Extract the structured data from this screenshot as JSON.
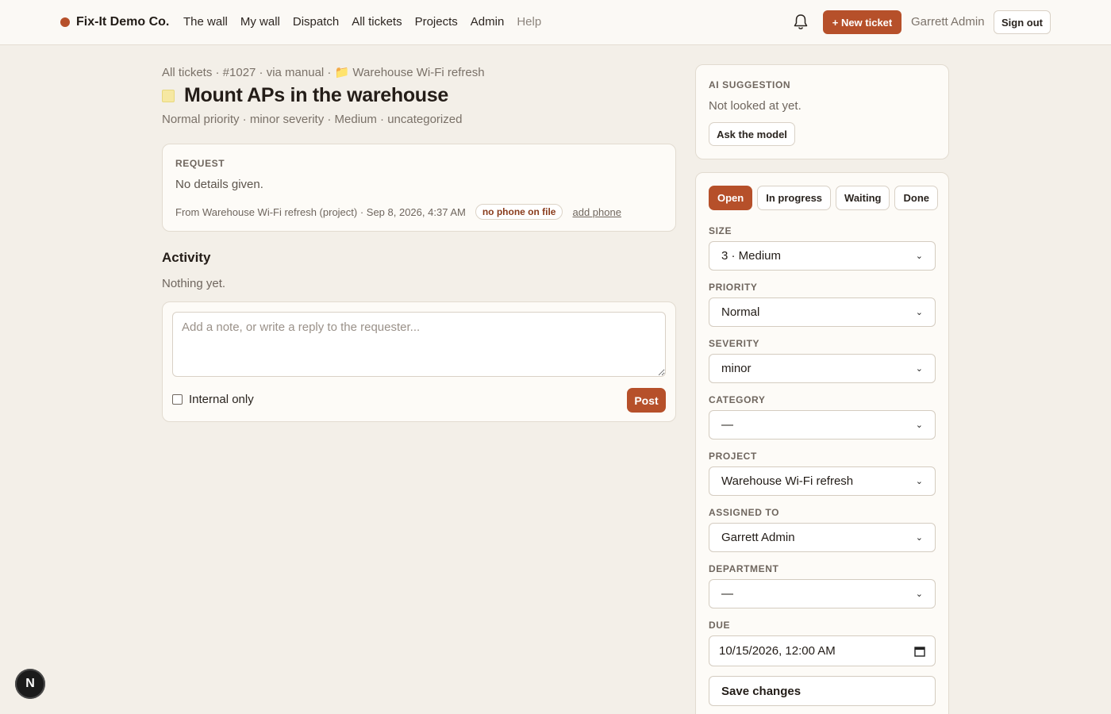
{
  "brand": {
    "name": "Fix-It Demo Co.",
    "dot_color": "#b6502a"
  },
  "nav": {
    "items": [
      {
        "label": "The wall"
      },
      {
        "label": "My wall"
      },
      {
        "label": "Dispatch"
      },
      {
        "label": "All tickets"
      },
      {
        "label": "Projects"
      },
      {
        "label": "Admin"
      },
      {
        "label": "Help"
      }
    ]
  },
  "header": {
    "notifications_icon": "bell-icon",
    "new_ticket_label": "+ New ticket",
    "user_name": "Garrett Admin",
    "sign_out_label": "Sign out",
    "accent": "#b6502a"
  },
  "ticket": {
    "breadcrumb": "All tickets · #1027 · via manual · 📁 Warehouse Wi-Fi refresh",
    "title": "Mount APs in the warehouse",
    "meta": "Normal priority · minor severity · Medium · uncategorized",
    "request": {
      "heading": "REQUEST",
      "body": "No details given.",
      "from": "From Warehouse Wi-Fi refresh (project) · Sep 8, 2026, 4:37 AM",
      "phone_badge": "no phone on file",
      "add_phone_label": "add phone"
    }
  },
  "activity": {
    "heading": "Activity",
    "empty_text": "Nothing yet.",
    "compose_placeholder": "Add a note, or write a reply to the requester...",
    "internal_label": "Internal only",
    "internal_checked": false,
    "post_label": "Post"
  },
  "ai": {
    "heading": "AI SUGGESTION",
    "status": "Not looked at yet.",
    "ask_label": "Ask the model"
  },
  "panel": {
    "statuses": [
      {
        "label": "Open",
        "active": true
      },
      {
        "label": "In progress",
        "active": false
      },
      {
        "label": "Waiting",
        "active": false
      },
      {
        "label": "Done",
        "active": false
      }
    ],
    "fields": {
      "size": {
        "label": "SIZE",
        "value": "3 · Medium"
      },
      "priority": {
        "label": "PRIORITY",
        "value": "Normal"
      },
      "severity": {
        "label": "SEVERITY",
        "value": "minor"
      },
      "category": {
        "label": "CATEGORY",
        "value": "—"
      },
      "project": {
        "label": "PROJECT",
        "value": "Warehouse Wi-Fi refresh"
      },
      "assigned": {
        "label": "ASSIGNED TO",
        "value": "Garrett Admin"
      },
      "department": {
        "label": "DEPARTMENT",
        "value": "—"
      },
      "due": {
        "label": "DUE",
        "value": "10/15/2026, 12:00 AM"
      }
    },
    "save_label": "Save changes"
  },
  "dev_badge": "N"
}
